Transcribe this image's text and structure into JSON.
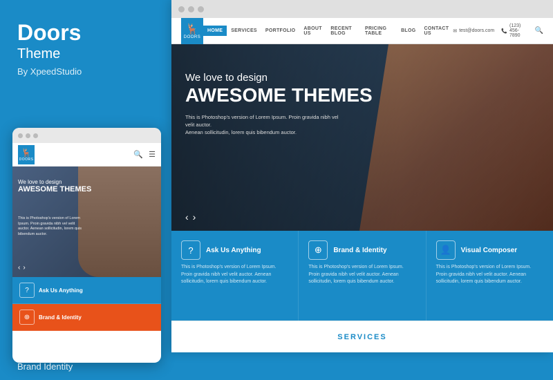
{
  "left": {
    "brand": "Doors",
    "subtitle": "Theme",
    "by": "By XpeedStudio",
    "bottom_text": "Brand Identity"
  },
  "mobile": {
    "dots": [
      "•",
      "•",
      "•"
    ],
    "logo_text": "DOORS",
    "hero": {
      "line1": "We love to design",
      "line2": "awesome THEMES",
      "desc": "This is Photoshop's version of Lorem Ipsum. Proin gravida nibh vel velit auctor. Aenean sollicitudin, lorem quis bibendum auctor."
    },
    "cards": [
      {
        "label": "Ask Us Anything",
        "icon": "?"
      },
      {
        "label": "Brand & Identity",
        "icon": "⊕"
      }
    ]
  },
  "desktop": {
    "dots": [
      "•",
      "•",
      "•"
    ],
    "logo_text": "DOORS",
    "nav": {
      "items": [
        "HOME",
        "SERVICES",
        "PORTFOLIO",
        "ABOUT US",
        "RECENT BLOG",
        "PRICING TABLE",
        "BLOG",
        "CONTACT US"
      ],
      "active": "HOME",
      "email": "test@doors.com",
      "phone": "(123) 456-7890"
    },
    "hero": {
      "line1": "We love to design",
      "line2": "awesome THEMES",
      "desc_line1": "This is Photoshop's version of Lorem Ipsum. Proin gravida nibh vel velit auctor.",
      "desc_line2": "Aenean sollicitudin, lorem quis bibendum auctor."
    },
    "cards": [
      {
        "icon": "?",
        "title": "Ask Us Anything",
        "text": "This is Photoshop's version of Lorem Ipsum. Proin gravida nibh vel velit auctor. Aenean sollicitudin, lorem quis bibendum auctor."
      },
      {
        "icon": "⊕",
        "title": "Brand & Identity",
        "text": "This is Photoshop's version of Lorem Ipsum. Proin gravida nibh vel velit auctor. Aenean sollicitudin, lorem quis bibendum auctor."
      },
      {
        "icon": "👤",
        "title": "Visual Composer",
        "text": "This is Photoshop's version of Lorem Ipsum. Proin gravida nibh vel velit auctor. Aenean sollicitudin, lorem quis bibendum auctor."
      }
    ],
    "services_label": "SERVICES"
  }
}
